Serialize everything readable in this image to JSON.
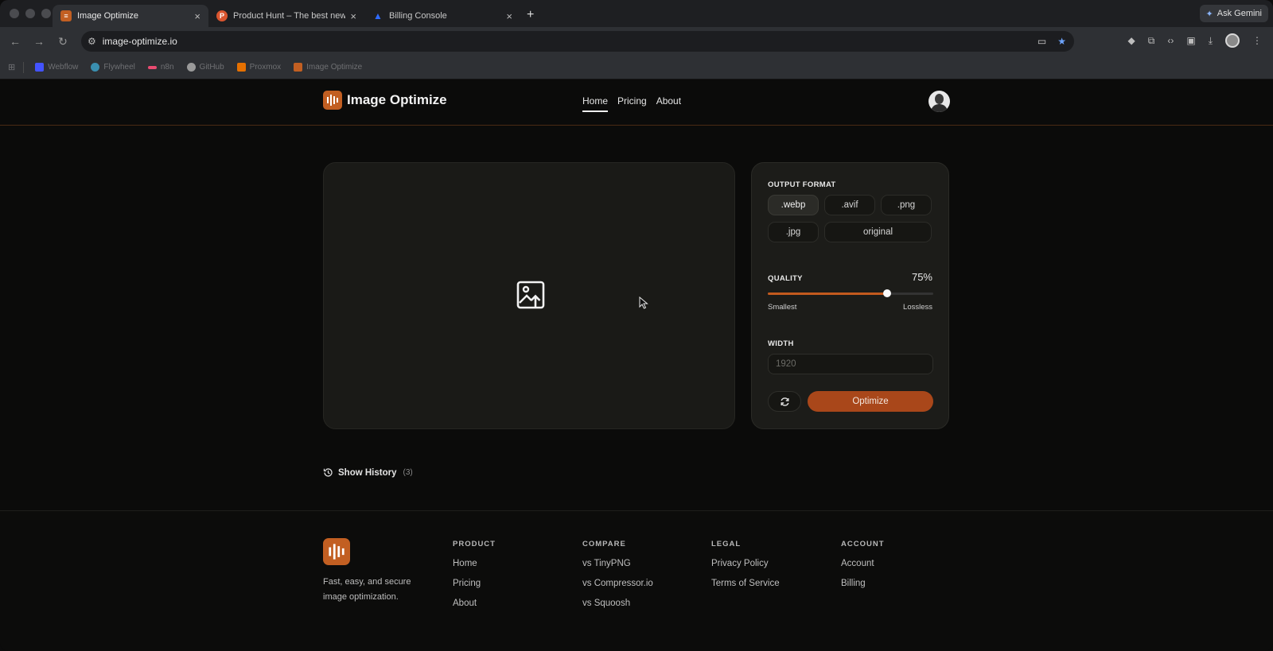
{
  "browser": {
    "tabs": [
      {
        "title": "Image Optimize",
        "favicon_color": "#c25f22",
        "favicon_glyph": "≡",
        "active": true
      },
      {
        "title": "Product Hunt – The best new",
        "favicon_color": "#da552f",
        "favicon_glyph": "P",
        "active": false
      },
      {
        "title": "Billing Console",
        "favicon_color": "#2f6bff",
        "favicon_glyph": "▲",
        "active": false
      }
    ],
    "new_tab": "+",
    "ask_gemini": "Ask Gemini",
    "url": "image-optimize.io",
    "bookmarks": [
      {
        "label": "Webflow",
        "color": "#4353ff"
      },
      {
        "label": "Flywheel",
        "color": "#3a8fb0"
      },
      {
        "label": "n8n",
        "color": "#ea4b71"
      },
      {
        "label": "GitHub",
        "color": "#9a9a9a"
      },
      {
        "label": "Proxmox",
        "color": "#e57000"
      },
      {
        "label": "Image Optimize",
        "color": "#c25f22"
      }
    ]
  },
  "site": {
    "brand": "Image Optimize",
    "nav": [
      {
        "label": "Home",
        "active": true
      },
      {
        "label": "Pricing",
        "active": false
      },
      {
        "label": "About",
        "active": false
      }
    ]
  },
  "settings": {
    "output_format_label": "OUTPUT FORMAT",
    "formats": [
      ".webp",
      ".avif",
      ".png",
      ".jpg",
      "original"
    ],
    "selected_format": ".webp",
    "quality_label": "QUALITY",
    "quality_value": "75%",
    "quality_fraction": 0.72,
    "quality_min_label": "Smallest",
    "quality_max_label": "Lossless",
    "width_label": "WIDTH",
    "width_placeholder": "1920",
    "optimize_label": "Optimize"
  },
  "history": {
    "label": "Show History",
    "count": "(3)"
  },
  "footer": {
    "tagline": "Fast, easy, and secure image optimization.",
    "columns": [
      {
        "heading": "PRODUCT",
        "links": [
          "Home",
          "Pricing",
          "About"
        ]
      },
      {
        "heading": "COMPARE",
        "links": [
          "vs TinyPNG",
          "vs Compressor.io",
          "vs Squoosh"
        ]
      },
      {
        "heading": "LEGAL",
        "links": [
          "Privacy Policy",
          "Terms of Service"
        ]
      },
      {
        "heading": "ACCOUNT",
        "links": [
          "Account",
          "Billing"
        ]
      }
    ]
  },
  "colors": {
    "accent": "#c25f22",
    "button": "#a9471a",
    "background": "#0b0b0a"
  }
}
